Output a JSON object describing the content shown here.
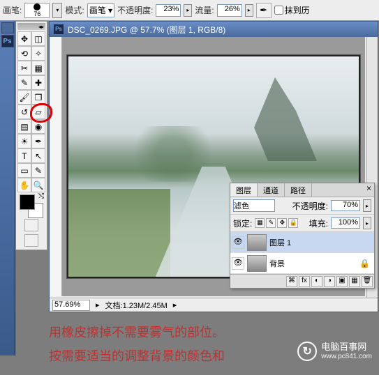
{
  "optionBar": {
    "brushLabel": "画笔:",
    "brushSize": "76",
    "modeLabel": "模式:",
    "modeValue": "画笔",
    "opacityLabel": "不透明度:",
    "opacityValue": "23%",
    "flowLabel": "流量:",
    "flowValue": "26%",
    "airbrushIcon": "airbrush-icon",
    "extraCheckbox": "抹到历"
  },
  "appStripe": {
    "logo": "Ps"
  },
  "toolbox": {
    "tools": [
      [
        "move",
        "marquee"
      ],
      [
        "lasso",
        "wand"
      ],
      [
        "crop",
        "slice"
      ],
      [
        "eyedrop",
        "patch"
      ],
      [
        "brush",
        "stamp"
      ],
      [
        "history",
        "eraser"
      ],
      [
        "gradient",
        "blur"
      ],
      [
        "dodge",
        "pen"
      ],
      [
        "type",
        "path"
      ],
      [
        "shape",
        "notes"
      ],
      [
        "hand",
        "zoom"
      ]
    ],
    "highlightedIndex": 5,
    "highlightedCol": 1
  },
  "document": {
    "title": "DSC_0269.JPG @ 57.7% (图层 1, RGB/8)",
    "zoom": "57.69%",
    "docSize": "文档:1.23M/2.45M"
  },
  "layersPanel": {
    "tabs": [
      "图层",
      "通道",
      "路径"
    ],
    "activeTab": 0,
    "blendMode": "滤色",
    "opacityLabel": "不透明度:",
    "opacityValue": "70%",
    "lockLabel": "锁定:",
    "fillLabel": "填充:",
    "fillValue": "100%",
    "layers": [
      {
        "name": "图层 1",
        "visible": true,
        "selected": true
      },
      {
        "name": "背景",
        "visible": true,
        "selected": false
      }
    ]
  },
  "caption": {
    "line1": "用橡皮擦掉不需要雾气的部位。",
    "line2": "按需要适当的调整背景的颜色和"
  },
  "watermark": {
    "brand": "电脑百事网",
    "url": "www.pc841.com",
    "logoGlyph": "↻"
  }
}
